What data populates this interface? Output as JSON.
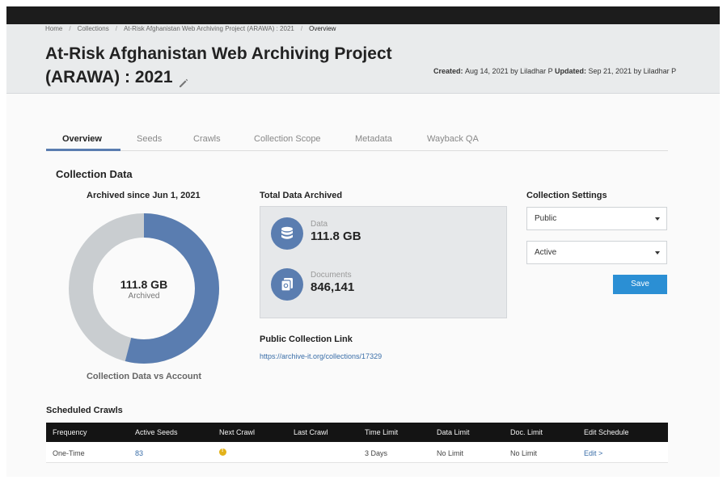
{
  "breadcrumb": {
    "items": [
      "Home",
      "Collections",
      "At-Risk Afghanistan Web Archiving Project (ARAWA) : 2021",
      "Overview"
    ]
  },
  "header": {
    "title": "At-Risk Afghanistan Web Archiving Project (ARAWA) : 2021",
    "created_label": "Created:",
    "created_value": "Aug 14, 2021 by Liladhar P",
    "updated_label": "Updated:",
    "updated_value": "Sep 21, 2021 by Liladhar P"
  },
  "tabs": [
    {
      "label": "Overview",
      "active": true
    },
    {
      "label": "Seeds",
      "active": false
    },
    {
      "label": "Crawls",
      "active": false
    },
    {
      "label": "Collection Scope",
      "active": false
    },
    {
      "label": "Metadata",
      "active": false
    },
    {
      "label": "Wayback QA",
      "active": false
    }
  ],
  "collection_data": {
    "heading": "Collection Data",
    "archived_since": "Archived since Jun 1, 2021",
    "donut": {
      "value": "111.8 GB",
      "sublabel": "Archived",
      "caption": "Collection Data vs Account",
      "archived_fraction": 0.54,
      "colors": {
        "archived": "#5a7db0",
        "remaining": "#c9cdd0"
      }
    }
  },
  "total_data": {
    "heading": "Total Data Archived",
    "data_label": "Data",
    "data_value": "111.8 GB",
    "docs_label": "Documents",
    "docs_value": "846,141",
    "icons": {
      "data": "database-icon",
      "documents": "documents-icon"
    }
  },
  "public_link": {
    "heading": "Public Collection Link",
    "url": "https://archive-it.org/collections/17329"
  },
  "settings": {
    "heading": "Collection Settings",
    "visibility": "Public",
    "status": "Active",
    "save_label": "Save",
    "accent": "#2b8fd4"
  },
  "scheduled_crawls": {
    "heading": "Scheduled Crawls",
    "columns": [
      "Frequency",
      "Active Seeds",
      "Next Crawl",
      "Last Crawl",
      "Time Limit",
      "Data Limit",
      "Doc. Limit",
      "Edit Schedule"
    ],
    "rows": [
      {
        "frequency": "One-Time",
        "active_seeds": "83",
        "next_crawl_icon": "warning-icon",
        "last_crawl": "",
        "time_limit": "3 Days",
        "data_limit": "No Limit",
        "doc_limit": "No Limit",
        "edit": "Edit >"
      }
    ]
  }
}
